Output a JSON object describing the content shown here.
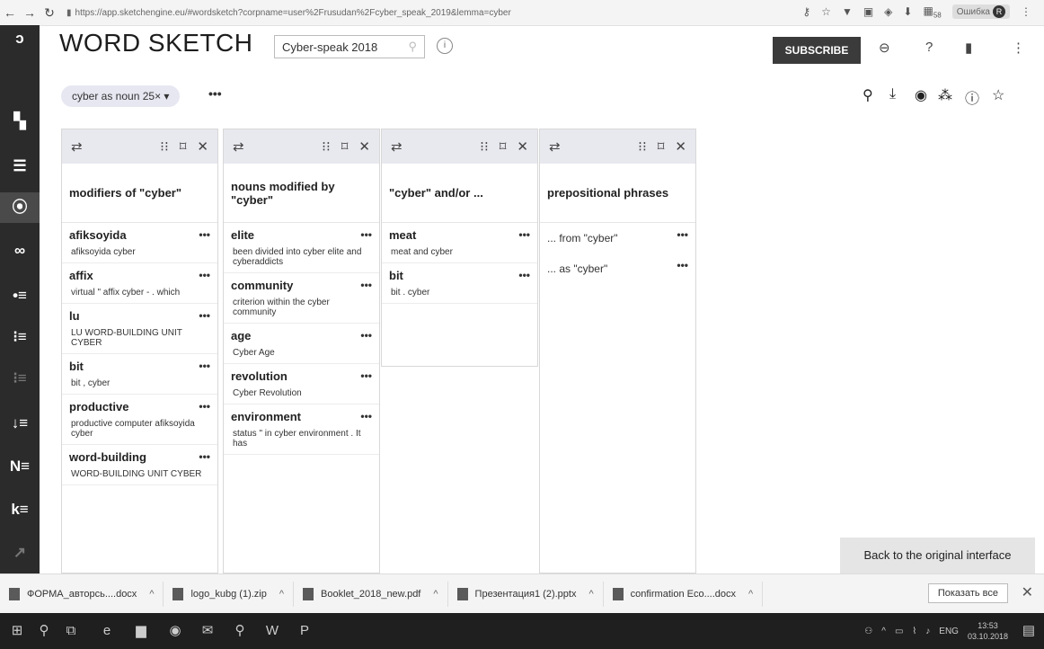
{
  "browser": {
    "url": "https://app.sketchengine.eu/#wordsketch?corpname=user%2Frusudan%2Fcyber_speak_2019&lemma=cyber",
    "profile_label": "Ошибка",
    "profile_initial": "R",
    "ext_badge": "58"
  },
  "app": {
    "title": "WORD SKETCH",
    "corpus_name": "Cyber-speak 2018",
    "subscribe_label": "SUBSCRIBE",
    "lemma_chip": "cyber as noun 25× ▾",
    "more": "•••",
    "back_label": "Back to the original interface"
  },
  "columns": [
    {
      "header": "modifiers of \"cyber\"",
      "entries": [
        {
          "word": "afiksoyida",
          "example": "afiksoyida cyber"
        },
        {
          "word": "affix",
          "example": "virtual \" affix cyber - . which"
        },
        {
          "word": "lu",
          "example": "LU WORD-BUILDING UNIT CYBER"
        },
        {
          "word": "bit",
          "example": "bit , cyber"
        },
        {
          "word": "productive",
          "example": "productive computer afiksoyida cyber"
        },
        {
          "word": "word-building",
          "example": "WORD-BUILDING UNIT CYBER"
        }
      ]
    },
    {
      "header": "nouns modified by \"cyber\"",
      "entries": [
        {
          "word": "elite",
          "example": "been divided into cyber elite and cyberaddicts"
        },
        {
          "word": "community",
          "example": "criterion within the cyber community"
        },
        {
          "word": "age",
          "example": "Cyber Age"
        },
        {
          "word": "revolution",
          "example": "Cyber Revolution"
        },
        {
          "word": "environment",
          "example": "status \" in cyber environment . It has"
        }
      ]
    },
    {
      "header": "\"cyber\" and/or ...",
      "entries": [
        {
          "word": "meat",
          "example": "meat and cyber"
        },
        {
          "word": "bit",
          "example": "bit . cyber"
        }
      ]
    },
    {
      "header": "prepositional phrases",
      "phrases": [
        "... from \"cyber\"",
        "... as \"cyber\""
      ]
    }
  ],
  "downloads": [
    {
      "name": "ФОРМА_авторсь....docx"
    },
    {
      "name": "logo_kubg (1).zip"
    },
    {
      "name": "Booklet_2018_new.pdf"
    },
    {
      "name": "Презентация1 (2).pptx"
    },
    {
      "name": "confirmation Eco....docx"
    }
  ],
  "downloads_show_all": "Показать все",
  "taskbar": {
    "lang": "ENG",
    "time": "13:53",
    "date": "03.10.2018"
  }
}
